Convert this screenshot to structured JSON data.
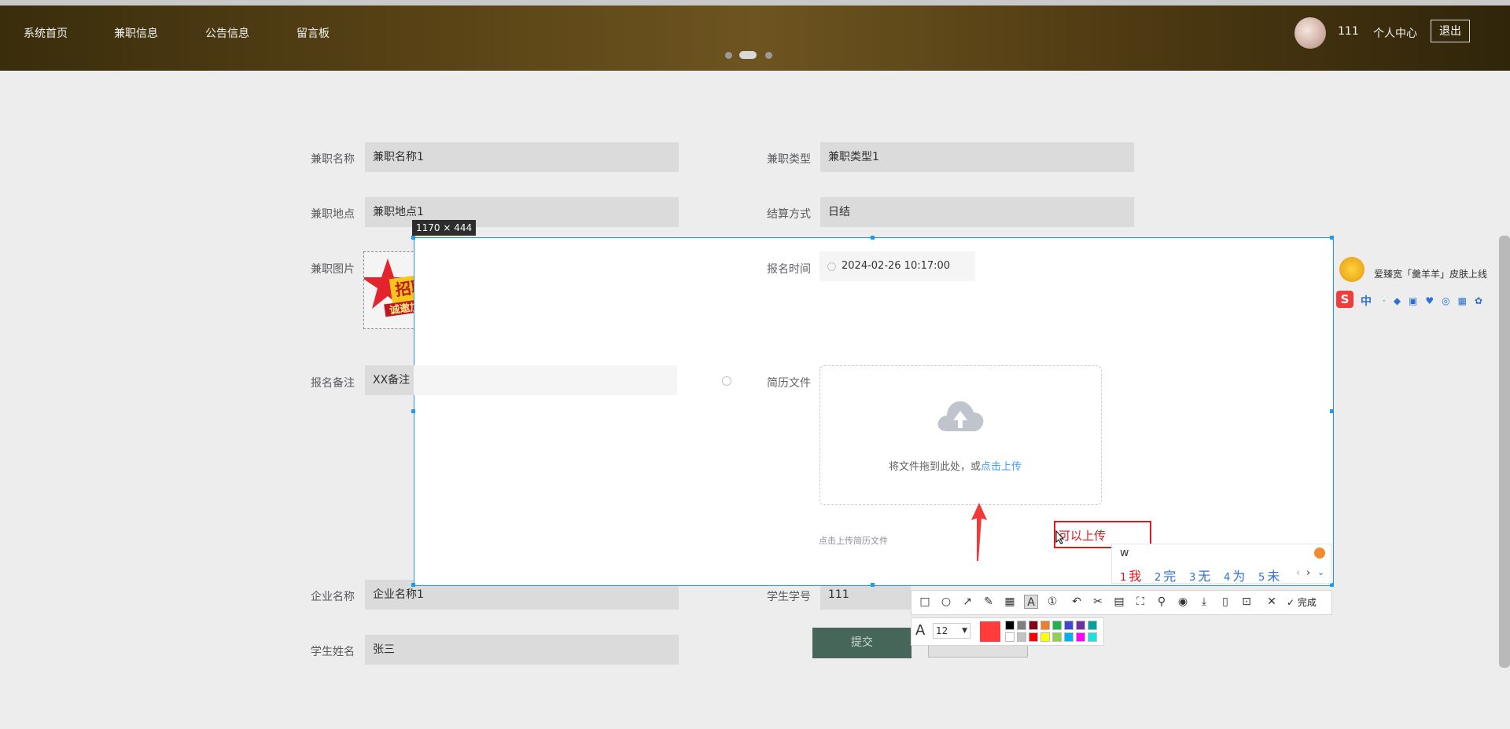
{
  "nav": {
    "home": "系统首页",
    "jobs": "兼职信息",
    "notices": "公告信息",
    "board": "留言板"
  },
  "user": {
    "id": "111",
    "center": "个人中心",
    "logout": "退出"
  },
  "form": {
    "job_name_label": "兼职名称",
    "job_name": "兼职名称1",
    "job_type_label": "兼职类型",
    "job_type": "兼职类型1",
    "job_place_label": "兼职地点",
    "job_place": "兼职地点1",
    "settle_label": "结算方式",
    "settle": "日结",
    "image_label": "兼职图片",
    "signup_time_label": "报名时间",
    "signup_time": "2024-02-26 10:17:00",
    "note_label": "报名备注",
    "note": "XX备注",
    "resume_label": "简历文件",
    "upload_text": "将文件拖到此处，或",
    "upload_link": "点击上传",
    "upload_hint": "点击上传简历文件",
    "company_label": "企业名称",
    "company": "企业名称1",
    "student_no_label": "学生学号",
    "student_no": "111",
    "student_name_label": "学生姓名",
    "student_name": "张三",
    "submit": "提交"
  },
  "capture": {
    "size": "1170 × 444",
    "annotation": "可以上传",
    "font_size": "12",
    "done": "完成",
    "palette": [
      "#000000",
      "#7f7f7f",
      "#880015",
      "#ed7d31",
      "#22b14c",
      "#3f48cc",
      "#7030a0",
      "#00a2a2",
      "#ffffff",
      "#c3c3c3",
      "#ff0000",
      "#ffff00",
      "#92d050",
      "#00b0f0",
      "#ff00ff",
      "#1ce0e0"
    ],
    "current_color": "#ff3b3b"
  },
  "ime": {
    "input": "w",
    "candidates": [
      {
        "n": "1",
        "t": "我"
      },
      {
        "n": "2",
        "t": "完"
      },
      {
        "n": "3",
        "t": "无"
      },
      {
        "n": "4",
        "t": "为"
      },
      {
        "n": "5",
        "t": "未"
      }
    ]
  },
  "sogou": {
    "promo": "爱臻宽「羹羊羊」皮肤上线",
    "mode": "中"
  }
}
